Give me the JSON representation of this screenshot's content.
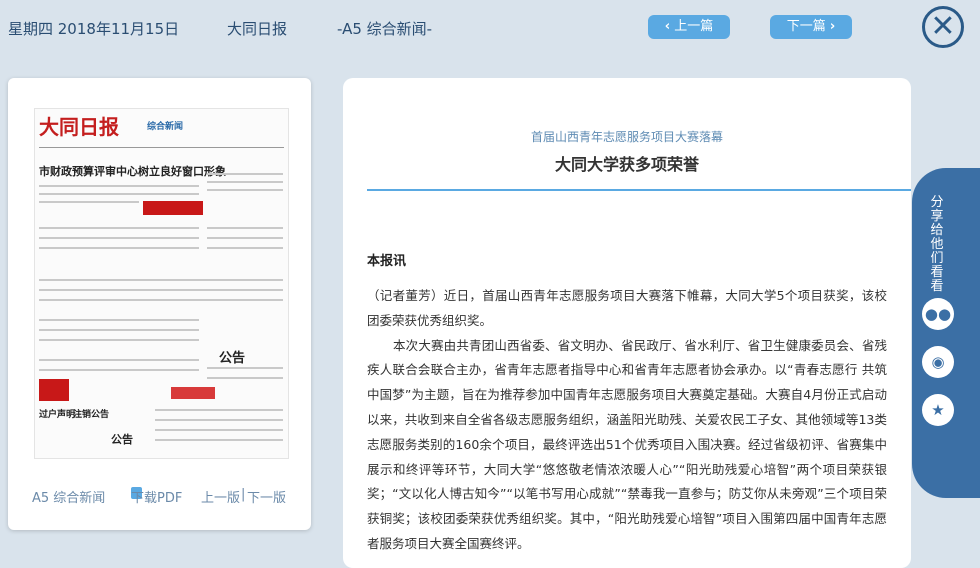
{
  "header": {
    "date": "星期四 2018年11月15日",
    "newspaper": "大同日报",
    "section": "-A5 综合新闻-",
    "prev_label": "上一篇",
    "next_label": "下一篇",
    "close_glyph": "✕"
  },
  "thumbnail": {
    "masthead": "大同日报",
    "badge": "综合新闻",
    "headline_main": "市财政预算评审中心树立良好窗口形象",
    "notice_label": "公告",
    "notice_label_2": "公告",
    "box_label_1": "过户声明",
    "box_label_2": "注销公告"
  },
  "card_footer": {
    "section": "A5 综合新闻",
    "download_pdf": "下载PDF",
    "prev_page": "上一版",
    "separator": "|",
    "next_page": "下一版"
  },
  "article": {
    "subtitle": "首届山西青年志愿服务项目大赛落幕",
    "title": "大同大学获多项荣誉",
    "lead": "本报讯",
    "paragraphs": [
      "（记者董芳）近日，首届山西青年志愿服务项目大赛落下帷幕，大同大学5个项目获奖，该校团委荣获优秀组织奖。",
      "本次大赛由共青团山西省委、省文明办、省民政厅、省水利厅、省卫生健康委员会、省残疾人联合会联合主办，省青年志愿者指导中心和省青年志愿者协会承办。以“青春志愿行 共筑中国梦”为主题，旨在为推荐参加中国青年志愿服务项目大赛奠定基础。大赛自4月份正式启动以来，共收到来自全省各级志愿服务组织，涵盖阳光助残、关爱农民工子女、其他领域等13类志愿服务类别的160余个项目，最终评选出51个优秀项目入围决赛。经过省级初评、省赛集中展示和终评等环节，大同大学“悠悠敬老情浓浓暖人心”“阳光助残爱心培智”两个项目荣获银奖；“文以化人博古知今”“以笔书写用心成就”“禁毒我一直参与；防艾你从未旁观”三个项目荣获铜奖；该校团委荣获优秀组织奖。其中，“阳光助残爱心培智”项目入围第四届中国青年志愿者服务项目大赛全国赛终评。"
    ]
  },
  "share": {
    "label": "分享给他们看看",
    "icons": [
      "wechat-icon",
      "weibo-icon",
      "qzone-icon"
    ]
  }
}
